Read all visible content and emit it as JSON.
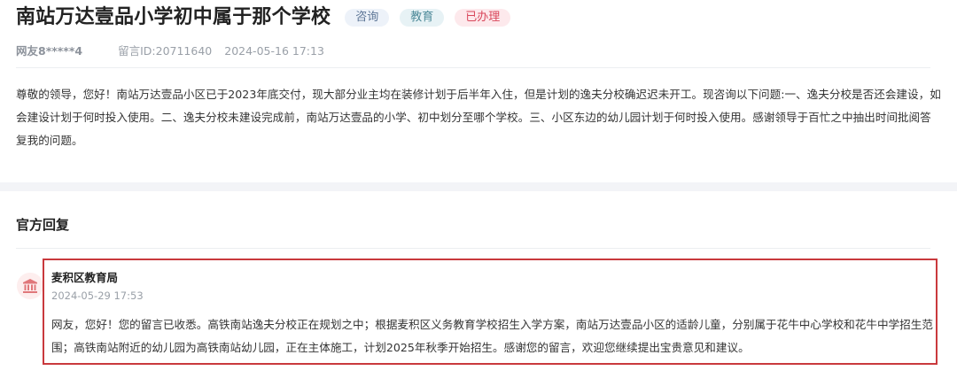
{
  "question": {
    "title": "南站万达壹品小学初中属于那个学校",
    "tags": [
      "咨询",
      "教育",
      "已办理"
    ],
    "user": "网友8*****4",
    "message_id": "留言ID:20711640",
    "datetime": "2024-05-16 17:13",
    "body": "尊敬的领导，您好！南站万达壹品小区已于2023年底交付，现大部分业主均在装修计划于后半年入住，但是计划的逸夫分校确迟迟未开工。现咨询以下问题:一、逸夫分校是否还会建设，如会建设计划于何时投入使用。二、逸夫分校未建设完成前，南站万达壹品的小学、初中划分至哪个学校。三、小区东边的幼儿园计划于何时投入使用。感谢领导于百忙之中抽出时间批阅答复我的问题。"
  },
  "reply": {
    "section_title": "官方回复",
    "org_icon": "government-building-icon",
    "org_name": "麦积区教育局",
    "datetime": "2024-05-29 17:53",
    "body": "网友，您好！您的留言已收悉。高铁南站逸夫分校正在规划之中；根据麦积区义务教育学校招生入学方案，南站万达壹品小区的适龄儿童，分别属于花牛中心学校和花牛中学招生范围；高铁南站附近的幼儿园为高铁南站幼儿园，正在主体施工，计划2025年秋季开始招生。感谢您的留言，欢迎您继续提出宝贵意见和建议。"
  },
  "colors": {
    "highlight_border": "#c9393d",
    "tag_consult_bg": "#edf2f9",
    "tag_edu_bg": "#e7f2f5",
    "tag_done_bg": "#fde9ec",
    "tag_done_text": "#d9475b",
    "icon_color": "#e0777a"
  }
}
